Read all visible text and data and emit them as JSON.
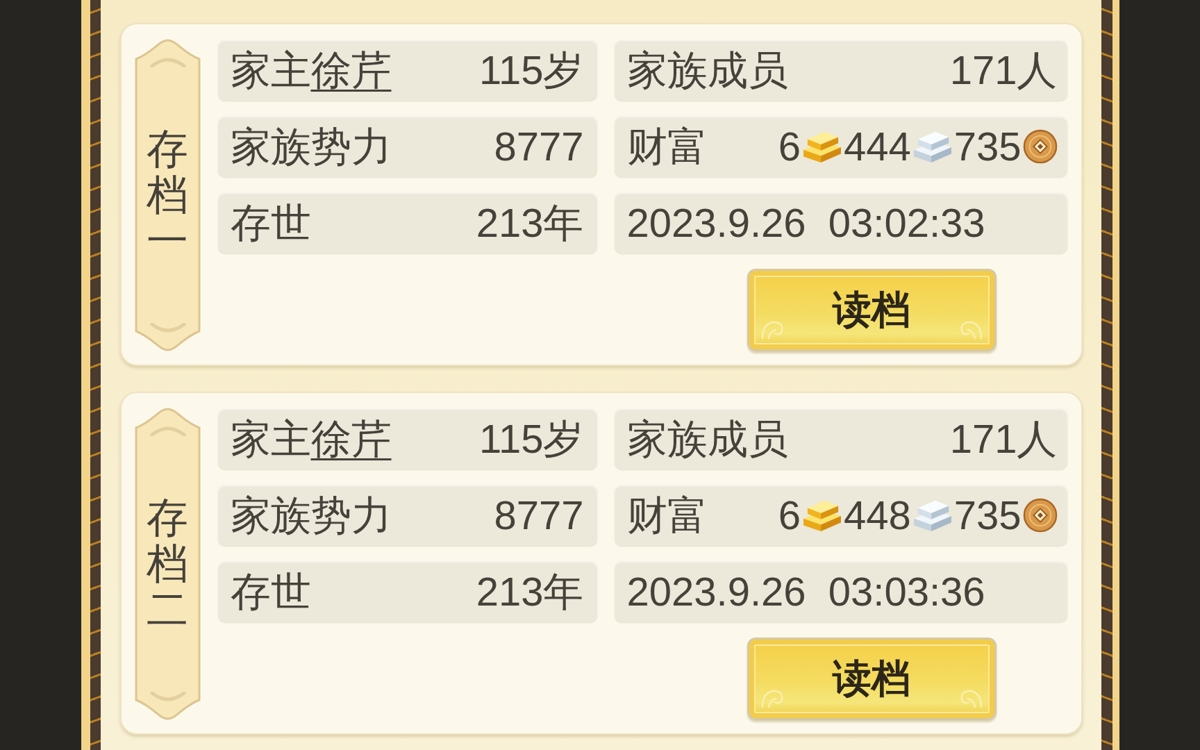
{
  "saves": [
    {
      "slot_title": "存档一",
      "head": {
        "label": "家主",
        "name": "徐芹",
        "age": "115岁"
      },
      "members": {
        "label": "家族成员",
        "value": "171人"
      },
      "power": {
        "label": "家族势力",
        "value": "8777"
      },
      "wealth": {
        "label": "财富",
        "amounts": [
          {
            "kind": "gold",
            "amount": "6"
          },
          {
            "kind": "silver",
            "amount": "444"
          },
          {
            "kind": "copper",
            "amount": "735"
          }
        ]
      },
      "years": {
        "label": "存世",
        "value": "213年"
      },
      "saved_at": "2023.9.26  03:02:33",
      "load_button": "读档"
    },
    {
      "slot_title": "存档二",
      "head": {
        "label": "家主",
        "name": "徐芹",
        "age": "115岁"
      },
      "members": {
        "label": "家族成员",
        "value": "171人"
      },
      "power": {
        "label": "家族势力",
        "value": "8777"
      },
      "wealth": {
        "label": "财富",
        "amounts": [
          {
            "kind": "gold",
            "amount": "6"
          },
          {
            "kind": "silver",
            "amount": "448"
          },
          {
            "kind": "copper",
            "amount": "735"
          }
        ]
      },
      "years": {
        "label": "存世",
        "value": "213年"
      },
      "saved_at": "2023.9.26  03:03:36",
      "load_button": "读档"
    }
  ]
}
